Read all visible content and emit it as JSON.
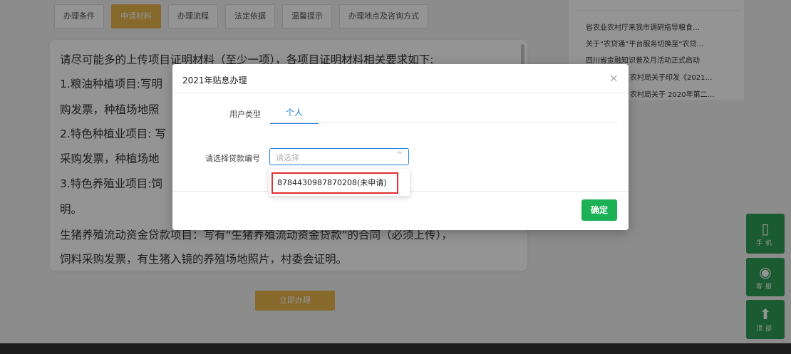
{
  "tabs": [
    {
      "label": "办理条件",
      "active": false
    },
    {
      "label": "申请材料",
      "active": true
    },
    {
      "label": "办理流程",
      "active": false
    },
    {
      "label": "法定依据",
      "active": false
    },
    {
      "label": "温馨提示",
      "active": false
    },
    {
      "label": "办理地点及咨询方式",
      "active": false
    }
  ],
  "content": {
    "lines": [
      "请尽可能多的上传项目证明材料（至少一项），各项目证明材料相关要求如下:",
      "1.粮油种植项目:写明",
      "购发票，种植场地照",
      "2.特色种植业项目: 写",
      "采购发票，种植场地",
      "3.特色养殖业项目:饲",
      "明。",
      "生猪养殖流动资金贷款项目：写有“生猪养殖流动资金贷款”的合同（必须上传），",
      "饲料采购发票，有生猪入镜的养殖场地照片，村委会证明。"
    ],
    "apply_button": "立即办理"
  },
  "news": [
    "省农业农村厅来我市调研指导粮食…",
    "关于“农贷通”平台服务切换至“农贷…",
    "四川省金融知识普及月活动正式启动",
    "农村局关于印发《2021…",
    "农村局关于 2020年第二…"
  ],
  "float_buttons": [
    {
      "glyph": "▯",
      "label": "手机"
    },
    {
      "glyph": "◉",
      "label": "客服"
    },
    {
      "glyph": "⬆",
      "label": "顶部"
    }
  ],
  "modal": {
    "title": "2021年贴息办理",
    "close": "×",
    "user_type_label": "用户类型",
    "user_type_tab": "个人",
    "loan_label": "请选择贷款编号",
    "select_placeholder": "请选择",
    "select_chevron": "^",
    "confirm": "确定"
  },
  "dropdown": {
    "options": [
      "8784430987870208(未申请)"
    ]
  },
  "colors": {
    "accent_gold": "#e7b54a",
    "primary_blue": "#1e7fe0",
    "confirm_green": "#1db155",
    "highlight_red": "#e03030",
    "float_green": "#2e9e57"
  }
}
